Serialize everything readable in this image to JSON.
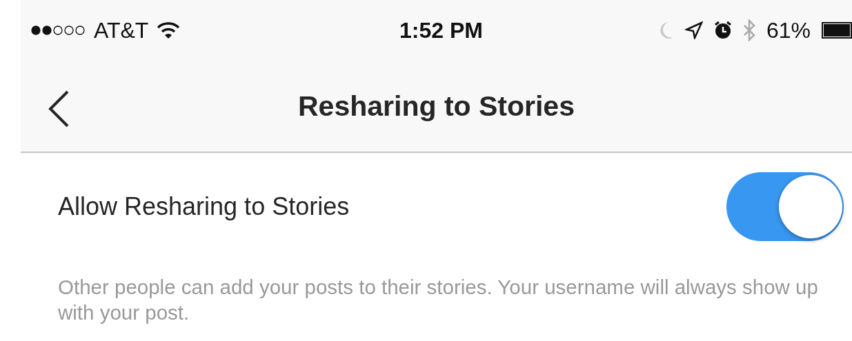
{
  "status_bar": {
    "carrier": "AT&T",
    "time": "1:52 PM",
    "battery": "61%"
  },
  "nav_bar": {
    "title": "Resharing to Stories"
  },
  "setting": {
    "label": "Allow Resharing to Stories",
    "on": true
  },
  "description": "Other people can add your posts to their stories. Your username will always show up with your post."
}
